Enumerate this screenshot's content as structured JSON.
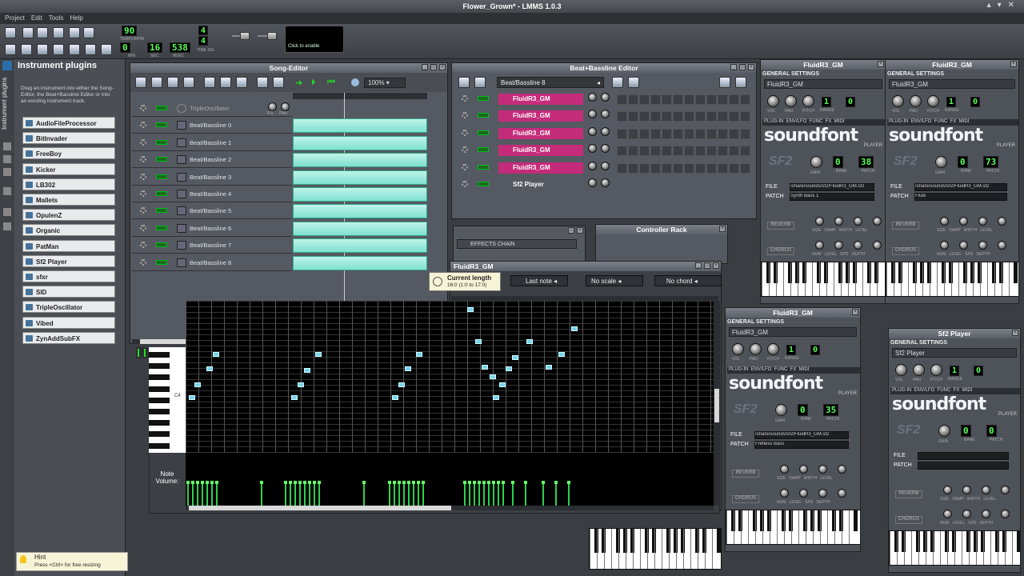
{
  "window": {
    "title": "Flower_Grown* - LMMS 1.0.3"
  },
  "menu": [
    "Project",
    "Edit",
    "Tools",
    "Help"
  ],
  "toolbar": {
    "tempo": "90",
    "tempo_label": "TEMPO/BPM",
    "time_min": "0",
    "time_sec": "16",
    "time_msec": "538",
    "min_label": "MIN",
    "sec_label": "SEC",
    "msec_label": "MSEC",
    "sig_top": "4",
    "sig_bottom": "4",
    "sig_label": "TIME SIG",
    "cpu_hint": "Click to enable"
  },
  "sidebar": {
    "tab_label": "Instrument plugins",
    "title": "Instrument plugins",
    "description": "Drag an instrument into either the Song-Editor, the Beat+Bassline Editor or into an existing instrument track.",
    "plugins": [
      "AudioFileProcessor",
      "BitInvader",
      "FreeBoy",
      "Kicker",
      "LB302",
      "Mallets",
      "OpulenZ",
      "Organic",
      "PatMan",
      "Sf2 Player",
      "sfxr",
      "SID",
      "TripleOscillator",
      "Vibed",
      "ZynAddSubFX"
    ]
  },
  "song_editor": {
    "title": "Song-Editor",
    "zoom": "100%",
    "tracks": [
      "TripleOscillator",
      "Beat/Bassline 0",
      "Beat/Bassline 1",
      "Beat/Bassline 2",
      "Beat/Bassline 3",
      "Beat/Bassline 4",
      "Beat/Bassline 5",
      "Beat/Bassline 6",
      "Beat/Bassline 7",
      "Beat/Bassline 8"
    ],
    "vol_label": "VOL",
    "pan_label": "PAN"
  },
  "bb_editor": {
    "title": "Beat+Bassline Editor",
    "selected": "Beat/Bassline 8",
    "tracks": [
      "FluidR3_GM",
      "FluidR3_GM",
      "FluidR3_GM",
      "FluidR3_GM",
      "FluidR3_GM",
      "Sf2 Player"
    ]
  },
  "fx_mixer": {
    "effects_chain": "EFFECTS CHAIN"
  },
  "controller_rack": {
    "title": "Controller Rack"
  },
  "piano_roll": {
    "title": "FluidR3_GM",
    "tooltip_title": "Current length",
    "tooltip_value": "16:0 (1:0 to 17:0)",
    "note_len": "Last note",
    "scale": "No scale",
    "chord": "No chord",
    "c4": "C4",
    "note_volume": "Note Volume:"
  },
  "instrument_windows": [
    {
      "title": "FluidR3_GM",
      "name": "FluidR3_GM",
      "range": "1",
      "fx": "0",
      "bank": "0",
      "patch": "38",
      "file": "/share/sounds/sf2/FluidR3_GM.sf2",
      "patch_name": "Synth Bass 1"
    },
    {
      "title": "FluidR3_GM",
      "name": "FluidR3_GM",
      "range": "1",
      "fx": "0",
      "bank": "0",
      "patch": "73",
      "file": "/share/sounds/sf2/FluidR3_GM.sf2",
      "patch_name": "Flute"
    },
    {
      "title": "FluidR3_GM",
      "name": "FluidR3_GM",
      "range": "1",
      "fx": "0",
      "bank": "0",
      "patch": "35",
      "file": "/share/sounds/sf2/FluidR3_GM.sf2",
      "patch_name": "Fretless Bass"
    },
    {
      "title": "Sf2 Player",
      "name": "Sf2 Player",
      "range": "1",
      "fx": "0",
      "bank": "0",
      "patch": "0",
      "file": "",
      "patch_name": ""
    }
  ],
  "inst_labels": {
    "general": "GENERAL SETTINGS",
    "tabs": "PLUG-IN  ENV/LFO  FUNC  FX  MIDI",
    "logo": "soundfont",
    "player": "PLAYER",
    "gain": "GAIN",
    "bank": "BANK",
    "patch": "PATCH",
    "file": "FILE",
    "patch_lbl": "PATCH",
    "reverb": "REVERB",
    "chorus": "CHORUS",
    "knobs1": "SIZE   DAMP   WIDTH   LEVEL",
    "knobs2": "NUM   LEVEL   SPD   DEPTH",
    "vol": "VOL",
    "pan": "PAN",
    "pitch": "PITCH",
    "range": "RANGE",
    "fx": "FX"
  },
  "hint": {
    "title": "Hint",
    "text": "Press <Ctrl> for free resizing"
  },
  "colors": {
    "pattern": "#a8eee0",
    "bb_track": "#c42c7a",
    "lcd_green": "#5aff5a",
    "note_vol": "#2fcf4a"
  }
}
